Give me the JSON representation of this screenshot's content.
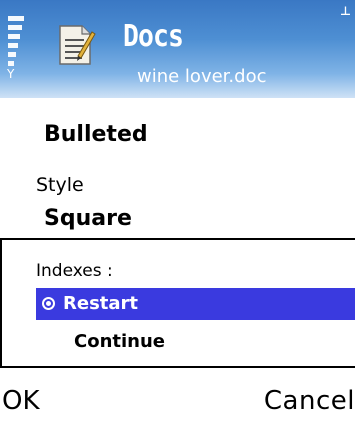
{
  "header": {
    "app_name": "Docs",
    "document_name": "wine lover.doc",
    "antenna_glyph": "Y",
    "battery_glyph": "⊥"
  },
  "form": {
    "list_type": "Bulleted",
    "style_label": "Style",
    "style_value": "Square"
  },
  "popup": {
    "title": "Indexes :",
    "options": [
      {
        "label": "Restart",
        "selected": true
      },
      {
        "label": "Continue",
        "selected": false
      }
    ]
  },
  "softkeys": {
    "left": "OK",
    "right": "Cancel"
  },
  "colors": {
    "header_gradient_top": "#3a78c4",
    "selection": "#3a3adf"
  },
  "icons": {
    "signal": "signal-strength-icon",
    "antenna": "antenna-icon",
    "app": "docs-app-icon",
    "radio": "radio-selected-icon"
  }
}
